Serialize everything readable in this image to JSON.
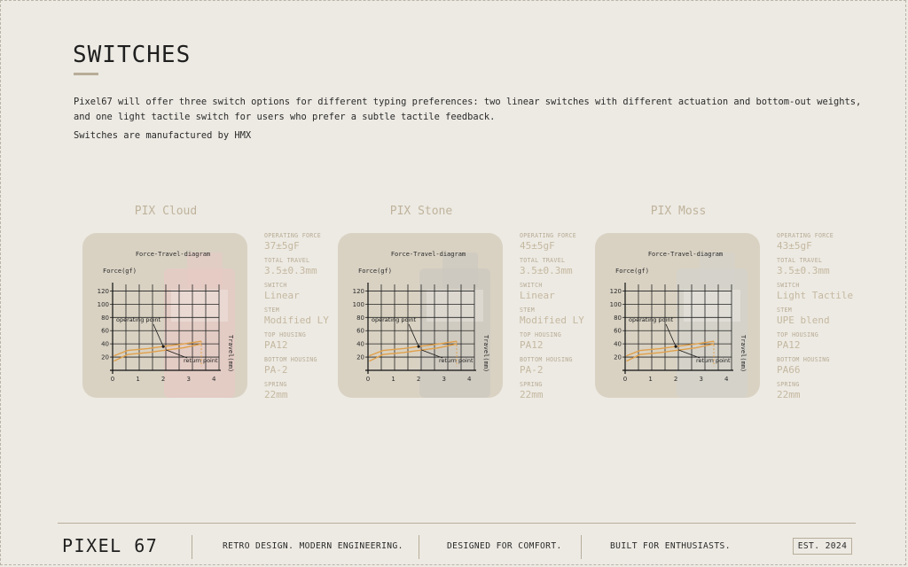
{
  "page": {
    "title": "SWITCHES",
    "intro": "Pixel67 will offer three switch options for different typing preferences: two linear switches with different actuation and bottom-out weights, and one light tactile switch for users who prefer a subtle tactile feedback.",
    "manufacturer": "Switches are manufactured by HMX"
  },
  "diagram": {
    "title": "Force-Travel-diagram",
    "ylabel": "Force(gf)",
    "xlabel": "Travel(mm)",
    "yticks": [
      "120",
      "100",
      "80",
      "60",
      "40",
      "20"
    ],
    "xticks": [
      "0",
      "1",
      "2",
      "3",
      "4"
    ],
    "operating_label": "operating point",
    "return_label": "return point"
  },
  "spec_labels": {
    "operating_force": "OPERATING FORCE",
    "total_travel": "TOTAL TRAVEL",
    "switch_type": "SWITCH",
    "stem": "STEM",
    "top_housing": "TOP HOUSING",
    "bottom_housing": "BOTTOM HOUSING",
    "spring": "SPRING"
  },
  "switches": [
    {
      "name": "PIX Cloud",
      "operating_force": "37±5gF",
      "total_travel": "3.5±0.3mm",
      "switch_type": "Linear",
      "stem": "Modified LY",
      "top_housing": "PA12",
      "bottom_housing": "PA-2",
      "spring": "22mm",
      "card_color": "#d9d2c3",
      "tint_color": "#e6c9c4"
    },
    {
      "name": "PIX Stone",
      "operating_force": "45±5gF",
      "total_travel": "3.5±0.3mm",
      "switch_type": "Linear",
      "stem": "Modified LY",
      "top_housing": "PA12",
      "bottom_housing": "PA-2",
      "spring": "22mm",
      "card_color": "#d9d2c3",
      "tint_color": "#ccc8c0"
    },
    {
      "name": "PIX Moss",
      "operating_force": "43±5gF",
      "total_travel": "3.5±0.3mm",
      "switch_type": "Light Tactile",
      "stem": "UPE blend",
      "top_housing": "PA12",
      "bottom_housing": "PA66",
      "spring": "22mm",
      "card_color": "#d9d2c3",
      "tint_color": "#d3d2cb"
    }
  ],
  "footer": {
    "brand": "PIXEL 67",
    "tagline1": "RETRO DESIGN. MODERN ENGINEERING.",
    "tagline2": "DESIGNED FOR COMFORT.",
    "tagline3": "BUILT FOR ENTHUSIASTS.",
    "est": "EST. 2024"
  },
  "colors": {
    "background": "#edeae3",
    "accent": "#b8ad98",
    "curve": "#e0a04a"
  }
}
